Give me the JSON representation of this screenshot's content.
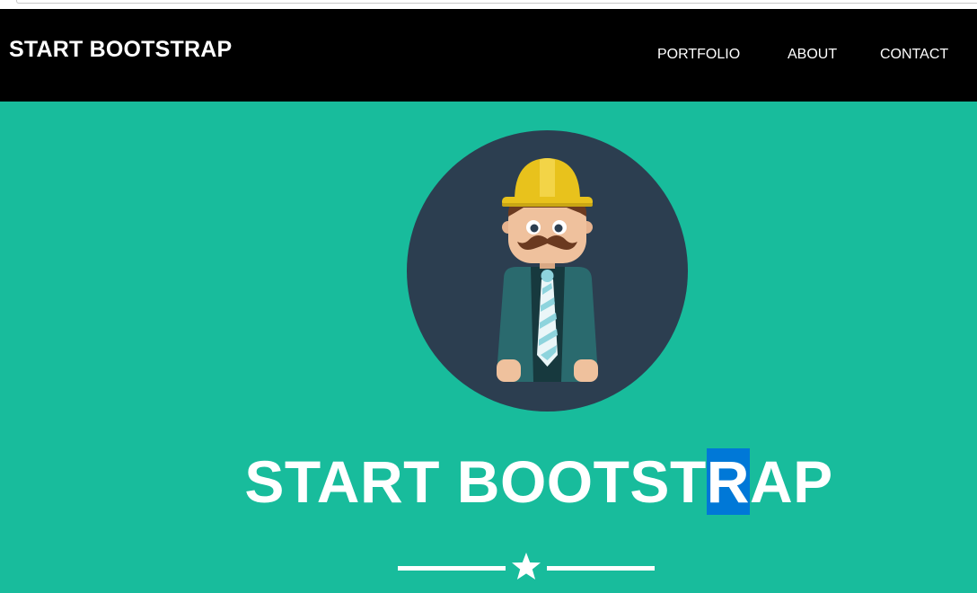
{
  "navbar": {
    "brand": "START BOOTSTRAP",
    "items": [
      {
        "label": "PORTFOLIO"
      },
      {
        "label": "ABOUT"
      },
      {
        "label": "CONTACT"
      }
    ]
  },
  "hero": {
    "title_before": "START BOOTST",
    "title_selected": "R",
    "title_after": "AP",
    "avatar_icon": "construction-worker-avatar-icon",
    "divider_icon": "star-icon"
  },
  "colors": {
    "background": "#18BC9C",
    "navbar": "#000000",
    "avatar_circle": "#2C3E50",
    "selection": "#0078D7",
    "text": "#FFFFFF"
  }
}
